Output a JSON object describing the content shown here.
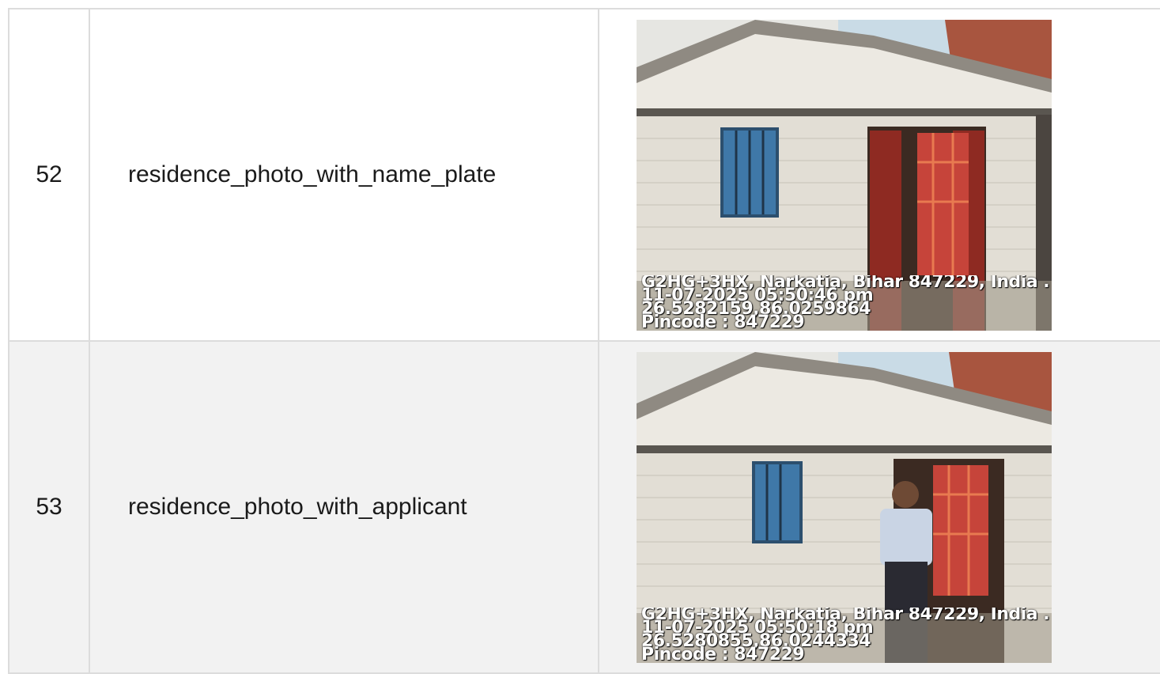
{
  "rows": [
    {
      "number": "52",
      "label": "residence_photo_with_name_plate",
      "photo": {
        "has_person": false,
        "stamp": [
          "G2HG+3HX, Narkatia, Bihar 847229, India ...",
          "11-07-2025 05:50:46 pm",
          "26.5282159,86.0259864",
          "Pincode : 847229"
        ]
      }
    },
    {
      "number": "53",
      "label": "residence_photo_with_applicant",
      "photo": {
        "has_person": true,
        "stamp": [
          "G2HG+3HX, Narkatia, Bihar 847229, India ...",
          "11-07-2025 05:50:18 pm",
          "26.5280855,86.0244334",
          "Pincode : 847229"
        ]
      }
    }
  ]
}
